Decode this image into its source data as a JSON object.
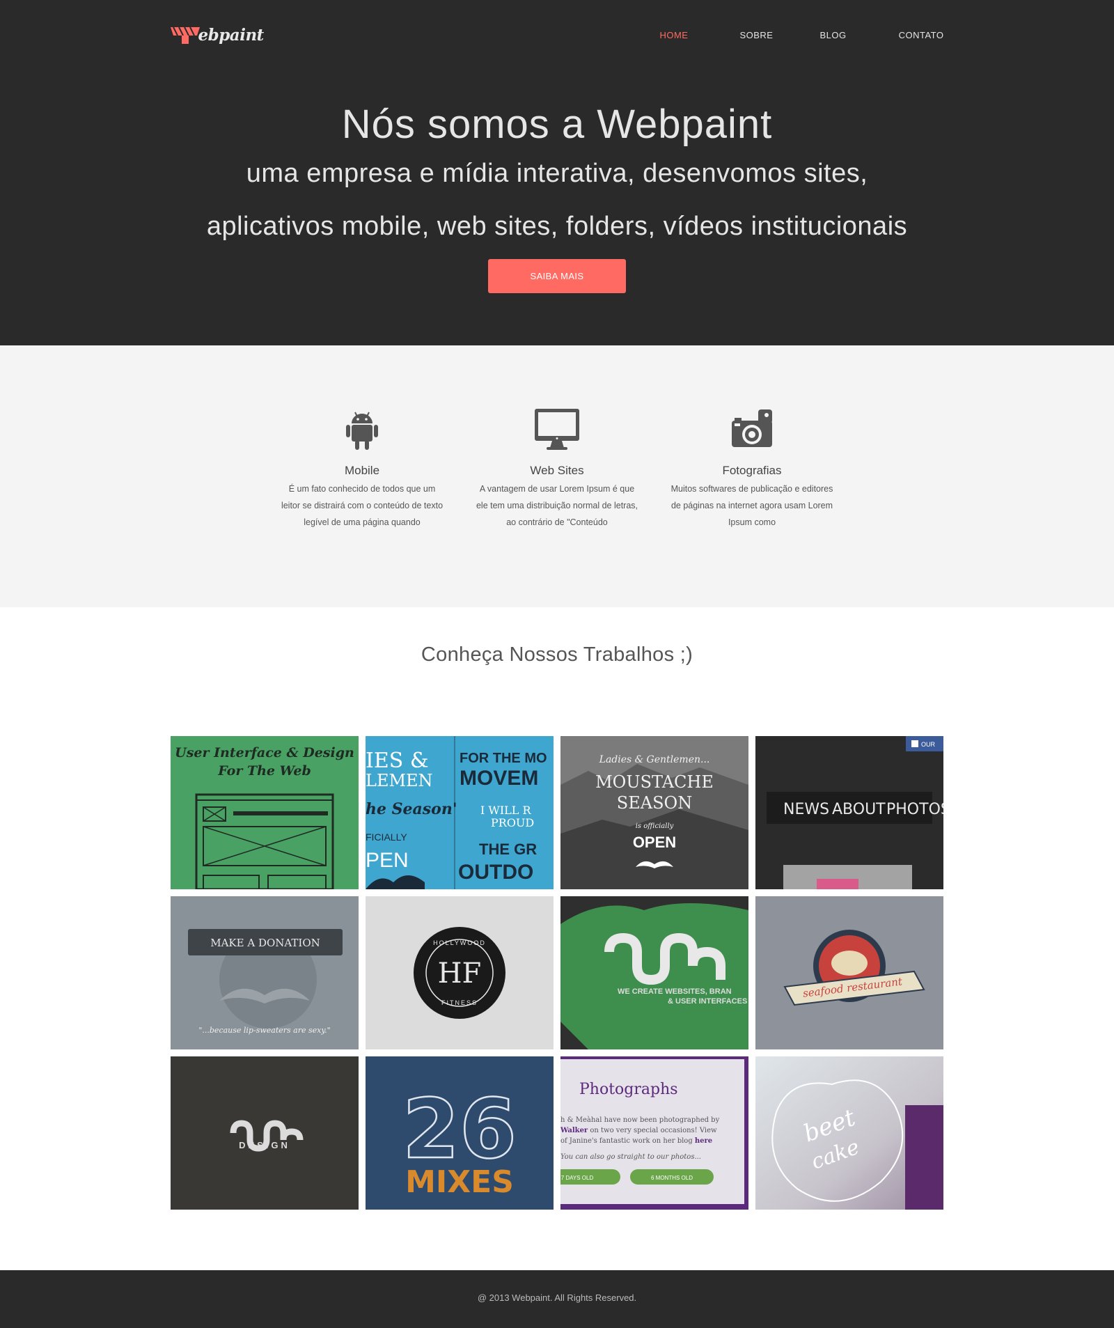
{
  "nav": {
    "logo_text": "ebpaint",
    "items": [
      {
        "label": "HOME",
        "active": true
      },
      {
        "label": "SOBRE",
        "active": false
      },
      {
        "label": "BLOG",
        "active": false
      },
      {
        "label": "CONTATO",
        "active": false
      }
    ]
  },
  "hero": {
    "title": "Nós somos a Webpaint",
    "subtitle_line1": "uma empresa e mídia interativa, desenvomos sites,",
    "subtitle_line2": "aplicativos mobile, web sites, folders, vídeos institucionais",
    "button_label": "SAIBA MAIS"
  },
  "features": [
    {
      "icon": "android-icon",
      "title": "Mobile",
      "text": "É um fato conhecido de todos que um leitor se distrairá com o conteúdo de texto legível de uma página quando"
    },
    {
      "icon": "monitor-icon",
      "title": "Web Sites",
      "text": "A vantagem de usar Lorem Ipsum é que ele tem uma distribuição normal de letras, ao contrário de \"Conteúdo"
    },
    {
      "icon": "camera-icon",
      "title": "Fotografias",
      "text": "Muitos softwares de publicação e editores de páginas na internet agora usam Lorem Ipsum como"
    }
  ],
  "portfolio": {
    "title": "Conheça Nossos Trabalhos ;)",
    "tiles": {
      "t1": {
        "line1": "User Interface & Design",
        "line2": "For The Web"
      },
      "t2": {
        "a": "IES &",
        "b": "LEMEN",
        "c": "FOR THE MO",
        "d": "MOVEM",
        "e": "he Season'",
        "f": "I WILL R",
        "g": "PROUD",
        "h": "FICIALLY",
        "i": "PEN",
        "j": "THE GR",
        "k": "OUTDO"
      },
      "t3": {
        "a": "Ladies & Gentlemen...",
        "b": "MOUSTACHE",
        "c": "SEASON",
        "d": "is officially",
        "e": "OPEN"
      },
      "t4": {
        "a": "NEWS",
        "b": "ABOUT",
        "c": "PHOTOS",
        "badge": "OUR"
      },
      "t5": {
        "a": "MAKE A DONATION",
        "b": "\"...because lip-sweaters are sexy.\""
      },
      "t6": {
        "a": "HOLLYWOOD",
        "b": "HF",
        "c": "FITNESS"
      },
      "t7": {
        "a": "WE CREATE WEBSITES, BRAN",
        "b": "& USER INTERFACES"
      },
      "t8": {
        "a": "seafood restaurant"
      },
      "t9": {
        "a": "DESIGN"
      },
      "t10": {
        "a": "26",
        "b": "MIXES"
      },
      "t11": {
        "a": "Photographs",
        "b": "h & Meàhal have now been photographed by",
        "c": "Walker",
        "c2": " on two very special occasions! View",
        "d": "of Janine's fantastic work on her blog ",
        "d2": "here",
        "e": "You can also go straight to our photos...",
        "f": "7 DAYS OLD",
        "g": "6 MONTHS OLD"
      },
      "t12": {
        "a": "beet",
        "b": "cake"
      }
    }
  },
  "footer": {
    "text": "@ 2013 Webpaint. All Rights Reserved."
  },
  "colors": {
    "dark": "#2a2a2a",
    "accent": "#ff6b63",
    "light_bg": "#f4f4f4"
  }
}
